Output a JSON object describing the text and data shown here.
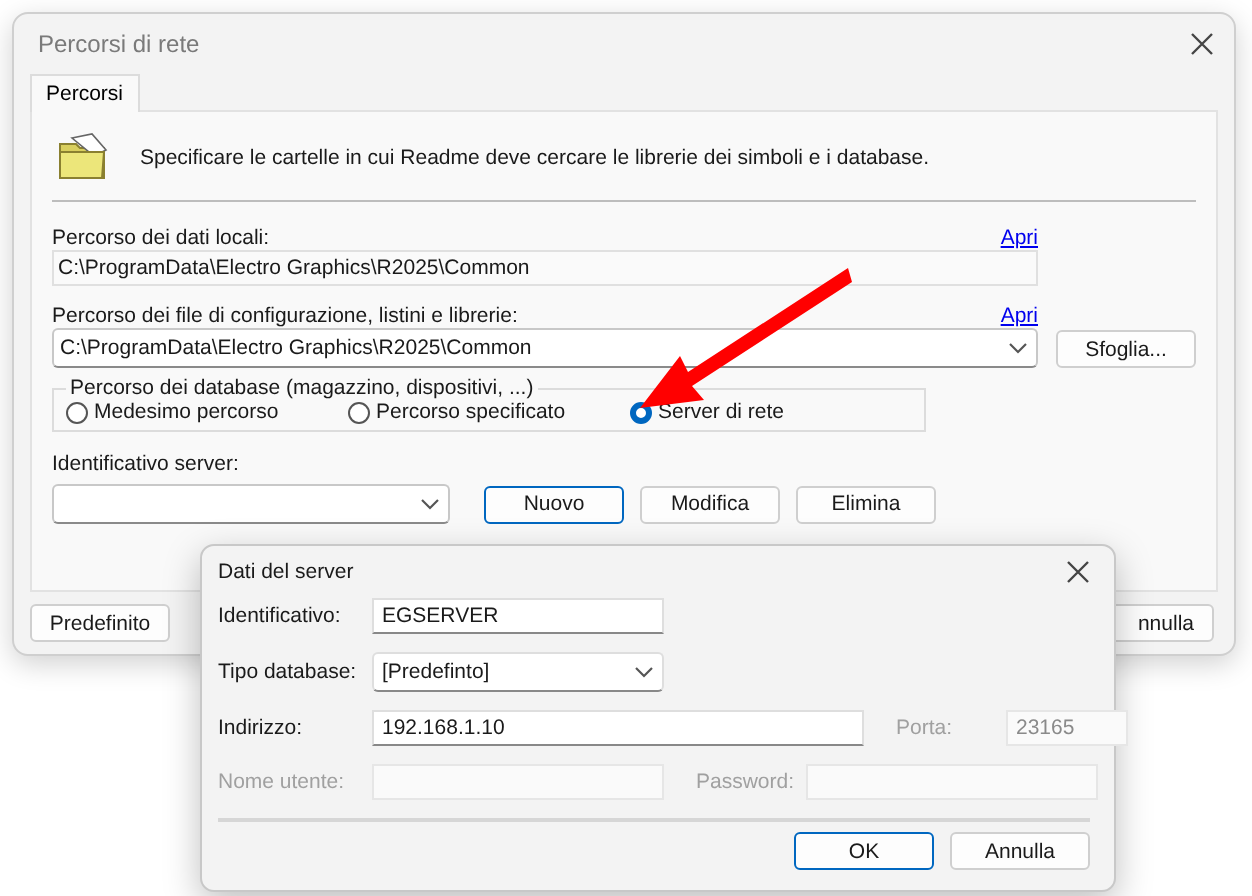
{
  "window": {
    "title": "Percorsi di rete"
  },
  "tabs": [
    {
      "label": "Percorsi",
      "selected": true
    }
  ],
  "intro": "Specificare le cartelle in cui Readme deve cercare le librerie dei simboli e i database.",
  "local_path": {
    "label": "Percorso dei dati locali:",
    "link": "Apri",
    "value": "C:\\ProgramData\\Electro Graphics\\R2025\\Common"
  },
  "config_path": {
    "label": "Percorso dei file di configurazione, listini e librerie:",
    "link": "Apri",
    "value": "C:\\ProgramData\\Electro Graphics\\R2025\\Common",
    "browse_button": "Sfoglia..."
  },
  "database_group": {
    "label": "Percorso dei database (magazzino, dispositivi, ...)",
    "options": [
      {
        "label": "Medesimo percorso",
        "selected": false
      },
      {
        "label": "Percorso specificato",
        "selected": false
      },
      {
        "label": "Server di rete",
        "selected": true
      }
    ]
  },
  "server_id": {
    "label": "Identificativo server:"
  },
  "server_buttons": [
    {
      "label": "Nuovo",
      "default": true
    },
    {
      "label": "Modifica",
      "default": false
    },
    {
      "label": "Elimina",
      "default": false
    }
  ],
  "footer_buttons": [
    "Predefinito",
    "nnulla"
  ],
  "server_dialog": {
    "title": "Dati del server",
    "rows": [
      [
        {
          "kind": "text",
          "label": "Identificativo:",
          "value": "EGSERVER",
          "disabled": false
        }
      ],
      [
        {
          "kind": "select",
          "label": "Tipo database:",
          "value": "[Predefinto]",
          "disabled": false
        }
      ],
      [
        {
          "kind": "text",
          "label": "Indirizzo:",
          "value": "192.168.1.10",
          "disabled": false
        },
        {
          "kind": "text",
          "label": "Porta:",
          "value": "23165",
          "disabled": true
        }
      ],
      [
        {
          "kind": "text",
          "label": "Nome utente:",
          "disabled": true
        },
        {
          "kind": "text",
          "label": "Password:",
          "disabled": true
        }
      ]
    ],
    "buttons": [
      {
        "label": "OK",
        "default": true
      },
      {
        "label": "Annulla",
        "default": false
      }
    ]
  }
}
